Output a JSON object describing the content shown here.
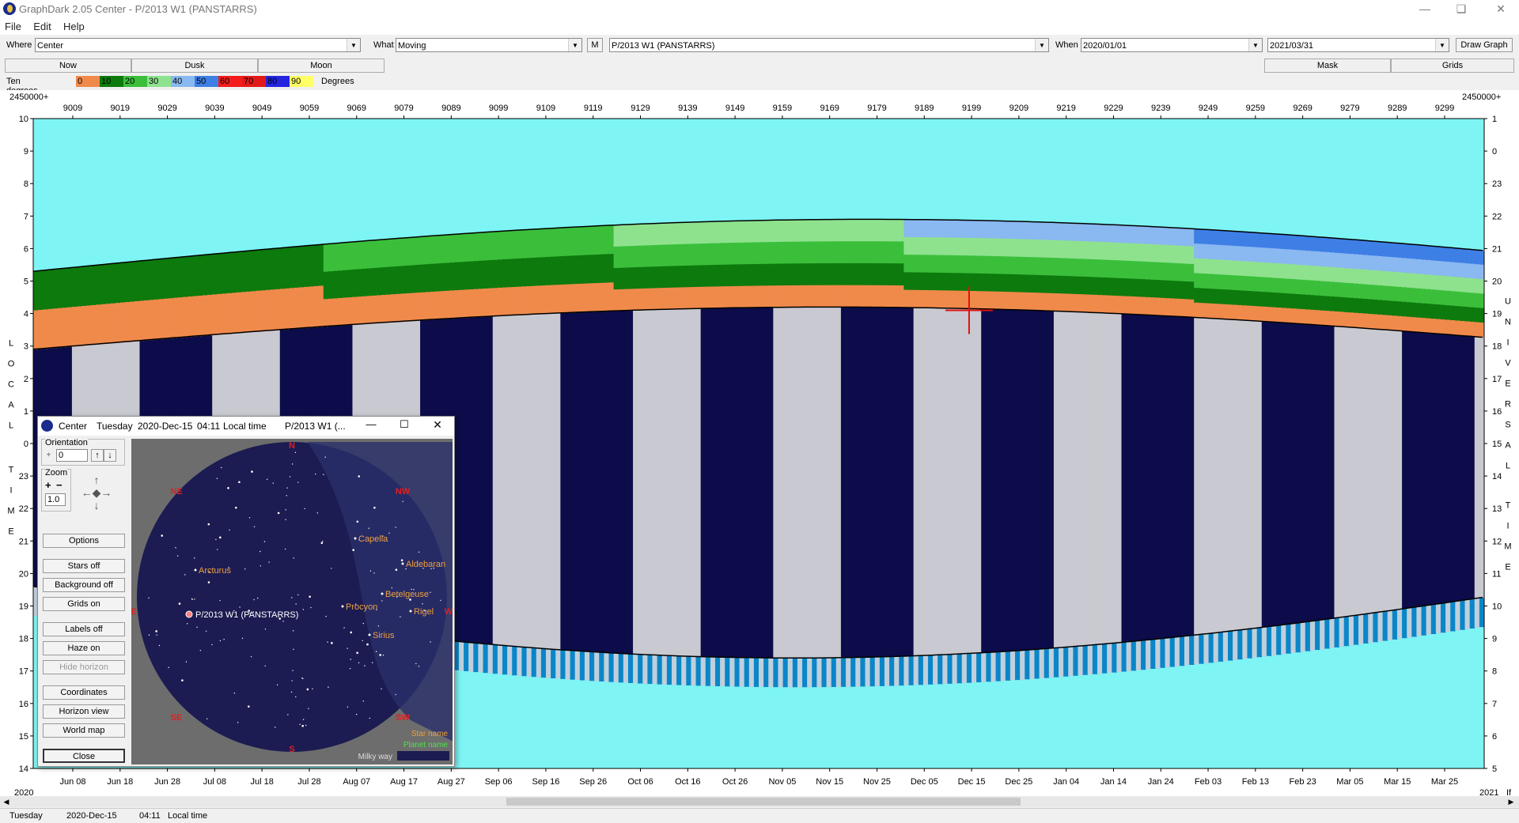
{
  "app": {
    "title": "GraphDark 2.05  Center  -  P/2013 W1 (PANSTARRS)",
    "menu": [
      "File",
      "Edit",
      "Help"
    ]
  },
  "toolbar": {
    "where_label": "Where",
    "where_value": "Center",
    "what_label": "What",
    "what_value": "Moving",
    "m_button": "M",
    "object_value": "P/2013 W1 (PANSTARRS)",
    "when_label": "When",
    "from_date": "2020/01/01",
    "to_date": "2021/03/31",
    "draw_button": "Draw Graph"
  },
  "tabs": {
    "now": "Now",
    "dusk": "Dusk",
    "moon": "Moon",
    "mask": "Mask",
    "grids": "Grids"
  },
  "legend": {
    "prefix": "Ten degrees",
    "suffix": "Degrees",
    "bands": [
      {
        "label": "0",
        "color": "#f08a4b"
      },
      {
        "label": "10",
        "color": "#0d7a0d"
      },
      {
        "label": "20",
        "color": "#3bbf3b"
      },
      {
        "label": "30",
        "color": "#8ee28e"
      },
      {
        "label": "40",
        "color": "#8ab8f0"
      },
      {
        "label": "50",
        "color": "#3e7fe6"
      },
      {
        "label": "60",
        "color": "#f31b1b"
      },
      {
        "label": "70",
        "color": "#e21919"
      },
      {
        "label": "80",
        "color": "#2525e0"
      },
      {
        "label": "90",
        "color": "#ffff66"
      }
    ]
  },
  "chart": {
    "jd_base_left": "2450000+",
    "jd_base_right": "2450000+",
    "jd_ticks": [
      "9009",
      "9019",
      "9029",
      "9039",
      "9049",
      "9059",
      "9069",
      "9079",
      "9089",
      "9099",
      "9109",
      "9119",
      "9129",
      "9139",
      "9149",
      "9159",
      "9169",
      "9179",
      "9189",
      "9199",
      "9209",
      "9219",
      "9229",
      "9239",
      "9249",
      "9259",
      "9269",
      "9279",
      "9289",
      "9299"
    ],
    "date_ticks": [
      "Jun 08",
      "Jun 18",
      "Jun 28",
      "Jul 08",
      "Jul 18",
      "Jul 28",
      "Aug 07",
      "Aug 17",
      "Aug 27",
      "Sep 06",
      "Sep 16",
      "Sep 26",
      "Oct 06",
      "Oct 16",
      "Oct 26",
      "Nov 05",
      "Nov 15",
      "Nov 25",
      "Dec 05",
      "Dec 15",
      "Dec 25",
      "Jan 04",
      "Jan 14",
      "Jan 24",
      "Feb 03",
      "Feb 13",
      "Feb 23",
      "Mar 05",
      "Mar 15",
      "Mar 25"
    ],
    "year_left": "2020",
    "year_right": "2021",
    "left_hours": [
      "10",
      "9",
      "8",
      "7",
      "6",
      "5",
      "4",
      "3",
      "2",
      "1",
      "0",
      "23",
      "22",
      "21",
      "20",
      "19",
      "18",
      "17",
      "16",
      "15",
      "14"
    ],
    "right_hours": [
      "1",
      "0",
      "23",
      "22",
      "21",
      "20",
      "19",
      "18",
      "17",
      "16",
      "15",
      "14",
      "13",
      "12",
      "11",
      "10",
      "9",
      "8",
      "7",
      "6",
      "5"
    ],
    "left_vertical_label": "LOCAL TIME",
    "right_vertical_label": "UNIVERSAL TIME",
    "corner_label": "If",
    "colors": {
      "sky": "#7ef4f4",
      "night": "#0c0c4a",
      "twilight": "#0a86c8",
      "moon": "#c9c9d1"
    }
  },
  "popup": {
    "icon": "graphdark-icon",
    "title": "Center",
    "day": "Tuesday",
    "date": "2020-Dec-15",
    "time": "04:11",
    "time_label": "Local time",
    "object": "P/2013 W1 (...",
    "orientation_label": "Orientation",
    "orientation_value": "0",
    "zoom_label": "Zoom",
    "zoom_value": "1.0",
    "buttons": [
      "Options",
      "Stars off",
      "Background off",
      "Grids on",
      "Labels off",
      "Haze on",
      "Hide horizon",
      "Coordinates",
      "Horizon view",
      "World map",
      "Close"
    ],
    "compass": [
      "N",
      "NW",
      "W",
      "SW",
      "S",
      "SE",
      "E",
      "NE"
    ],
    "stars": [
      "Capella",
      "Aldebaran",
      "Arcturus",
      "Betelgeuse",
      "Procyon",
      "Rigel",
      "Sirius"
    ],
    "target": "P/2013 W1 (PANSTARRS)",
    "legend_star_name": "Star name",
    "legend_planet_name": "Planet name",
    "legend_milky_way": "Milky way"
  },
  "status": {
    "day": "Tuesday",
    "date": "2020-Dec-15",
    "time": "04:11",
    "time_label": "Local time"
  }
}
